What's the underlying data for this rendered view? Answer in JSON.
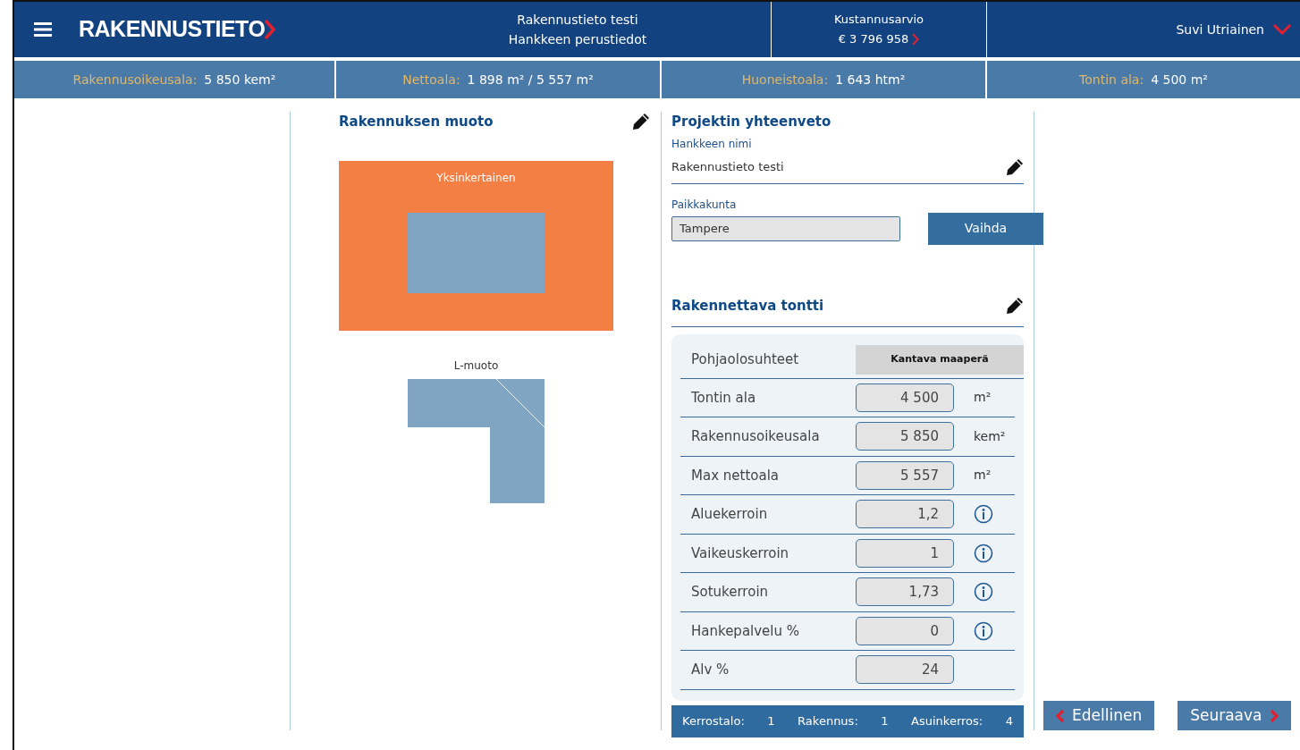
{
  "header": {
    "logo": "RAKENNUSTIETO",
    "project_title": "Rakennustieto testi",
    "page_title": "Hankkeen perustiedot",
    "estimate_label": "Kustannusarvio",
    "estimate_value": "€ 3 796 958",
    "user": "Suvi Utriainen"
  },
  "stats": [
    {
      "label": "Rakennusoikeusala:",
      "value": "5 850 kem²"
    },
    {
      "label": "Nettoala:",
      "value": "1 898 m² / 5 557 m²"
    },
    {
      "label": "Huoneistoala:",
      "value": "1 643 htm²"
    },
    {
      "label": "Tontin ala:",
      "value": "4 500 m²"
    }
  ],
  "building_shape": {
    "title": "Rakennuksen muoto",
    "options": [
      {
        "label": "Yksinkertainen",
        "kind": "rectangle",
        "selected": true
      },
      {
        "label": "L-muoto",
        "kind": "l-shape",
        "selected": false
      }
    ]
  },
  "summary": {
    "title": "Projektin yhteenveto",
    "name_label": "Hankkeen nimi",
    "name_value": "Rakennustieto testi",
    "place_label": "Paikkakunta",
    "place_value": "Tampere",
    "change_button": "Vaihda"
  },
  "plot": {
    "title": "Rakennettava tontti",
    "rows": [
      {
        "kind": "select",
        "label": "Pohjaolosuhteet",
        "value": "Kantava maaperä"
      },
      {
        "kind": "input",
        "label": "Tontin ala",
        "value": "4 500",
        "unit": "m²"
      },
      {
        "kind": "input",
        "label": "Rakennusoikeusala",
        "value": "5 850",
        "unit": "kem²"
      },
      {
        "kind": "input",
        "label": "Max nettoala",
        "value": "5 557",
        "unit": "m²"
      },
      {
        "kind": "info",
        "label": "Aluekerroin",
        "value": "1,2"
      },
      {
        "kind": "info",
        "label": "Vaikeuskerroin",
        "value": "1"
      },
      {
        "kind": "info",
        "label": "Sotukerroin",
        "value": "1,73"
      },
      {
        "kind": "info",
        "label": "Hankepalvelu %",
        "value": "0"
      },
      {
        "kind": "input",
        "label": "Alv %",
        "value": "24"
      }
    ],
    "totals": [
      {
        "label": "Kerrostalo:",
        "value": "1"
      },
      {
        "label": "Rakennus:",
        "value": "1"
      },
      {
        "label": "Asuinkerros:",
        "value": "4"
      }
    ]
  },
  "navigation": {
    "previous": "Edellinen",
    "next": "Seuraava"
  }
}
